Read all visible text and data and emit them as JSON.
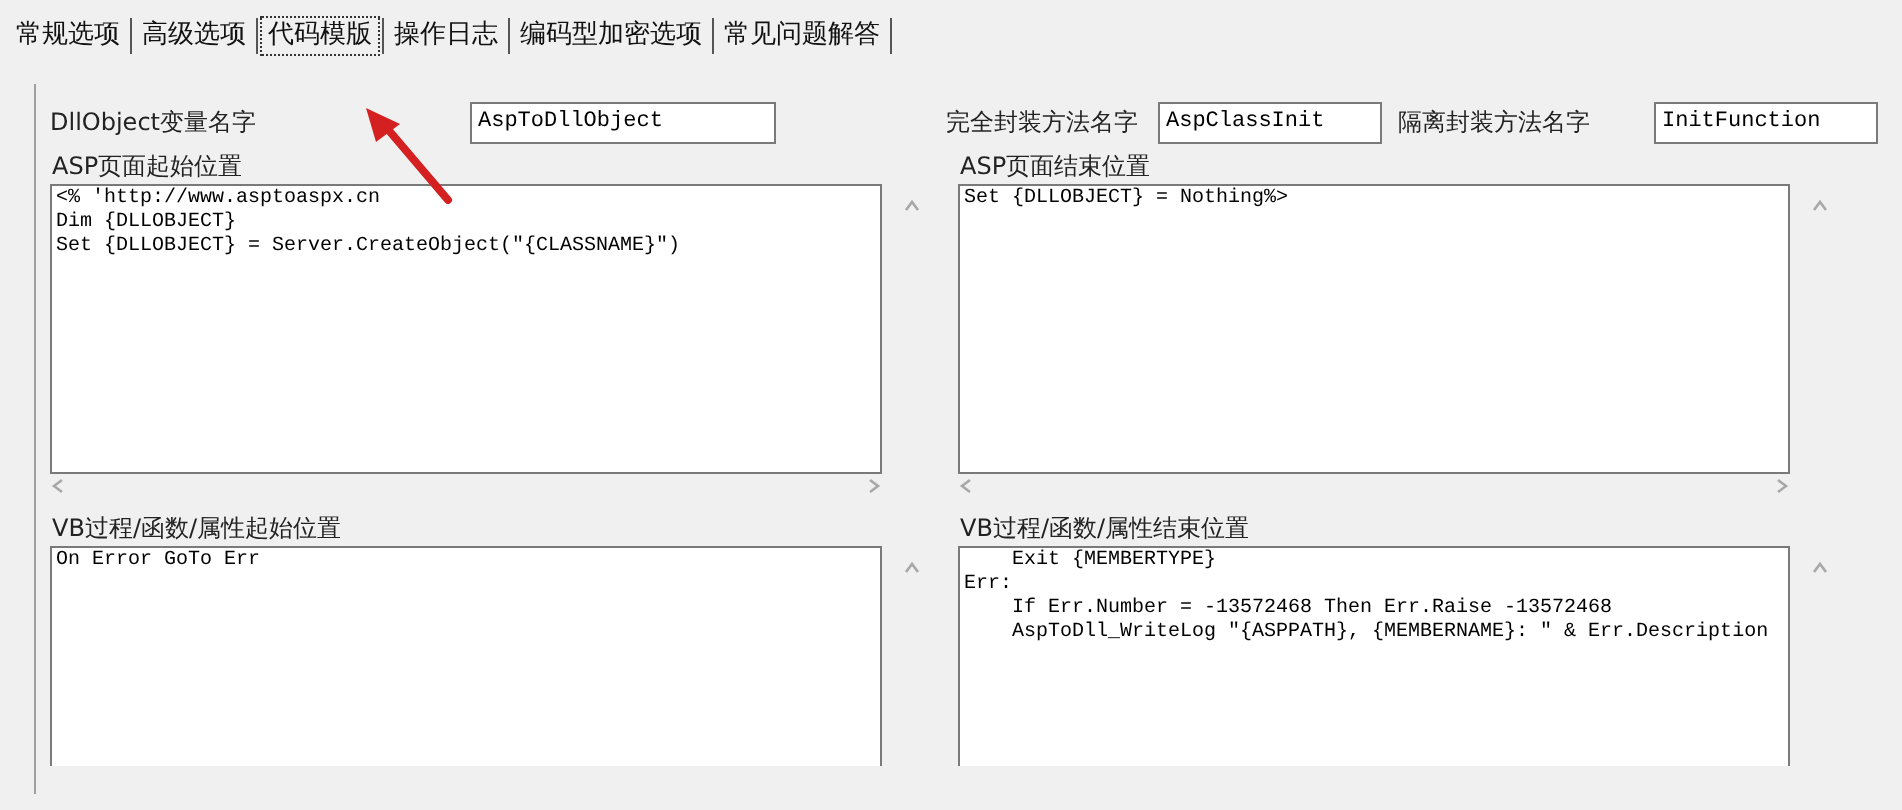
{
  "tabs": [
    {
      "label": "常规选项",
      "selected": false
    },
    {
      "label": "高级选项",
      "selected": false
    },
    {
      "label": "代码模版",
      "selected": true
    },
    {
      "label": "操作日志",
      "selected": false
    },
    {
      "label": "编码型加密选项",
      "selected": false
    },
    {
      "label": "常见问题解答",
      "selected": false
    }
  ],
  "fields": [
    {
      "label": "DllObject变量名字",
      "value": "AspToDllObject"
    },
    {
      "label": "完全封装方法名字",
      "value": "AspClassInit"
    },
    {
      "label": "隔离封装方法名字",
      "value": "InitFunction"
    }
  ],
  "editors": [
    {
      "label": "ASP页面起始位置",
      "value": "<% 'http://www.asptoaspx.cn\nDim {DLLOBJECT}\nSet {DLLOBJECT} = Server.CreateObject(\"{CLASSNAME}\")"
    },
    {
      "label": "ASP页面结束位置",
      "value": "Set {DLLOBJECT} = Nothing%>"
    },
    {
      "label": "VB过程/函数/属性起始位置",
      "value": "On Error GoTo Err"
    },
    {
      "label": "VB过程/函数/属性结束位置",
      "value": "    Exit {MEMBERTYPE}\nErr:\n    If Err.Number = -13572468 Then Err.Raise -13572468\n    AspToDll_WriteLog \"{ASPPATH}, {MEMBERNAME}: \" & Err.Description"
    }
  ]
}
